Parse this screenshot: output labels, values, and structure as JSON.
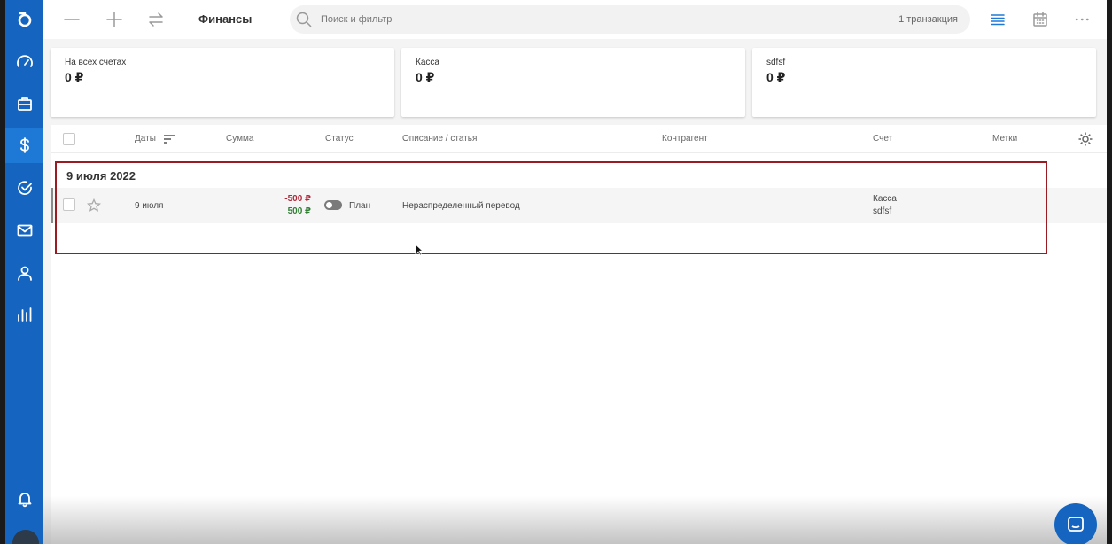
{
  "header": {
    "title": "Финансы",
    "search_placeholder": "Поиск и фильтр",
    "transaction_count": "1 транзакция"
  },
  "sidebar": {
    "icons": [
      "logo-icon",
      "speedometer-icon",
      "briefcase-icon",
      "dollar-icon",
      "check-circle-icon",
      "mail-icon",
      "user-icon",
      "bar-chart-icon",
      "bell-icon"
    ],
    "active": "dollar-icon"
  },
  "summary_cards": [
    {
      "label": "На всех счетах",
      "value": "0 ₽"
    },
    {
      "label": "Касса",
      "value": "0 ₽"
    },
    {
      "label": "sdfsf",
      "value": "0 ₽"
    }
  ],
  "table": {
    "columns": {
      "dates": "Даты",
      "amount": "Сумма",
      "status": "Статус",
      "description": "Описание / статья",
      "counterparty": "Контрагент",
      "account": "Счет",
      "tags": "Метки"
    },
    "groups": [
      {
        "title": "9 июля 2022",
        "rows": [
          {
            "date": "9 июля",
            "amount_out": "-500 ₽",
            "amount_in": "500 ₽",
            "status": "План",
            "description": "Нераспределенный перевод",
            "counterparty": "",
            "account_from": "Касса",
            "account_to": "sdfsf",
            "tags": ""
          }
        ]
      }
    ]
  },
  "colors": {
    "sidebar": "#1565c0",
    "negative": "#b0283a",
    "positive": "#2e7d32",
    "highlight": "#9a1c22"
  }
}
